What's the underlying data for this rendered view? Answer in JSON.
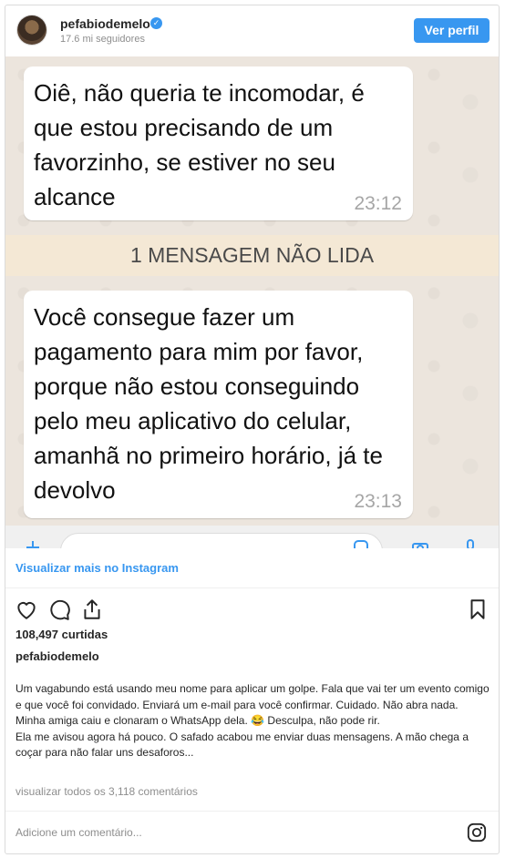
{
  "header": {
    "username": "pefabiodemelo",
    "verified_glyph": "✓",
    "followers": "17.6 mi seguidores",
    "follow_button": "Ver perfil"
  },
  "media": {
    "message1": {
      "text": "Oiê, não queria te incomodar, é que estou precisando de um favorzinho, se estiver no seu alcance",
      "time": "23:12"
    },
    "unread_banner": "1 MENSAGEM NÃO LIDA",
    "message2": {
      "text": "Você consegue fazer um pagamento para mim por favor, porque não estou conseguindo pelo meu aplicativo do celular, amanhã no primeiro horário, já te devolvo",
      "time": "23:13"
    }
  },
  "view_more_link": "Visualizar mais no Instagram",
  "actions": {
    "icons": [
      "heart-icon",
      "comment-icon",
      "share-icon",
      "bookmark-icon"
    ]
  },
  "likes": "108,497 curtidas",
  "caption": {
    "author": "pefabiodemelo",
    "paragraph1": "Um vagabundo está usando meu nome para aplicar um golpe. Fala que vai ter um evento comigo e que você foi convidado. Enviará um e-mail para você confirmar. Cuidado. Não abra nada. Minha amiga caiu e clonaram o WhatsApp dela. 😂 Desculpa, não pode rir.",
    "paragraph2": "Ela me avisou agora há pouco. O safado acabou me enviar duas mensagens. A mão chega a coçar para não falar uns desaforos..."
  },
  "comments_link": "visualizar todos os 3,118 comentários",
  "comment_placeholder": "Adicione um comentário...",
  "colors": {
    "accent": "#3897f0",
    "chat_background": "#ece5dd",
    "unread_banner": "#f4e8d5"
  }
}
